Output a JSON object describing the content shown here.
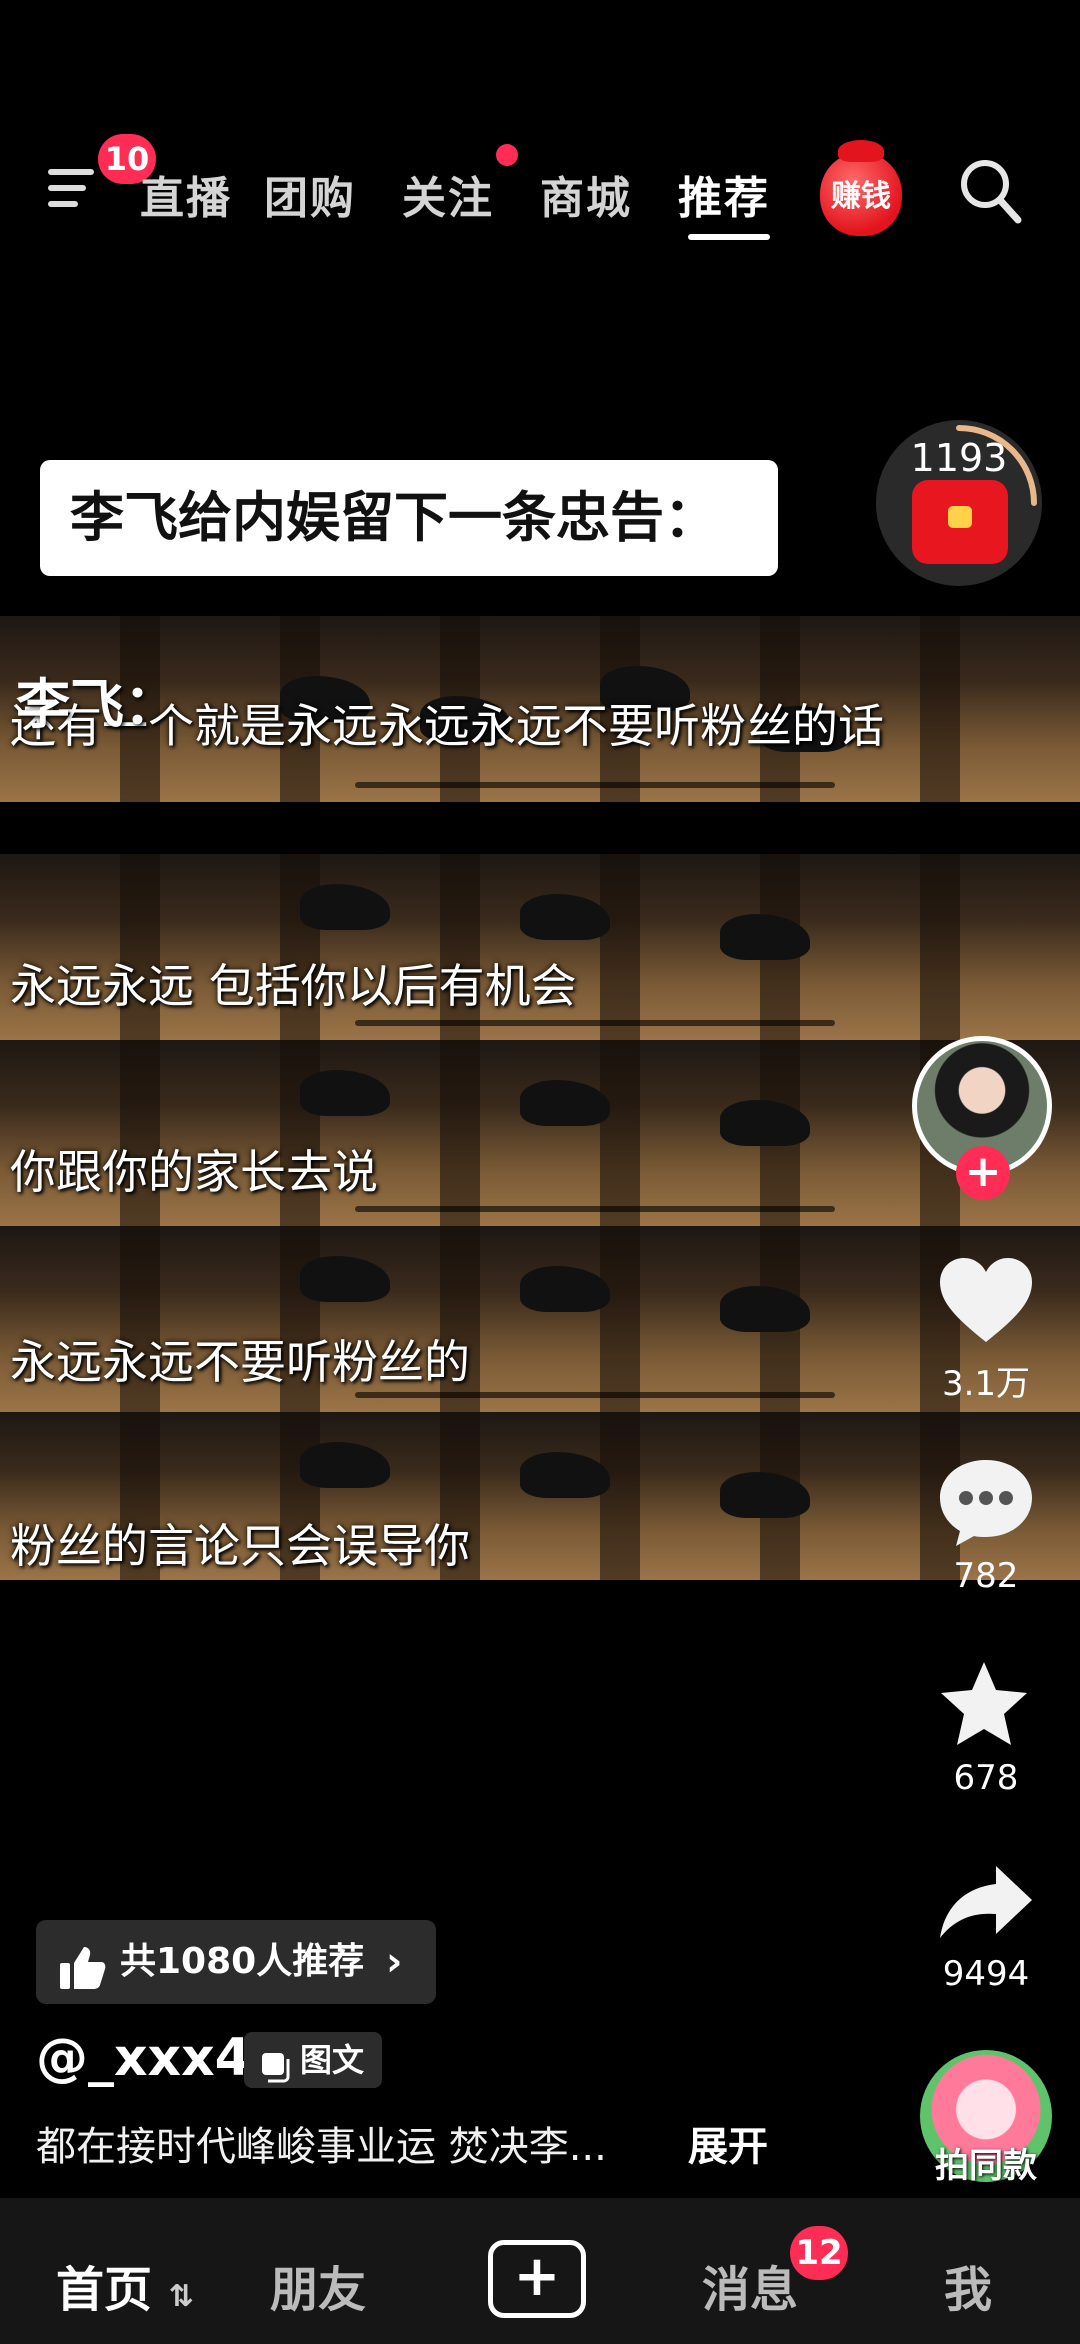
{
  "top_nav": {
    "menu_badge": "10",
    "tabs": [
      "直播",
      "团购",
      "关注",
      "商城",
      "推荐"
    ],
    "active_tab_index": 4,
    "earn_label": "赚钱"
  },
  "video": {
    "caption_title": "李飞给内娱留下一条忠告：",
    "speaker": "李飞：",
    "subtitles": [
      "还有一个就是永远永远永远不要听粉丝的话",
      "永远永远  包括你以后有机会",
      "你跟你的家长去说",
      "永远永远不要听粉丝的",
      "粉丝的言论只会误导你"
    ]
  },
  "timer_widget": {
    "count": "1193"
  },
  "right_rail": {
    "likes": "3.1万",
    "comments": "782",
    "favorites": "678",
    "shares": "9494",
    "remix_label": "拍同款"
  },
  "info": {
    "recommend_text": "共1080人推荐",
    "username": "@_xxx4",
    "type_tag": "图文",
    "description": "都在接时代峰峻事业运 焚决李...",
    "expand_label": "展开"
  },
  "bottom_bar": {
    "home": "首页",
    "friends": "朋友",
    "messages": "消息",
    "messages_badge": "12",
    "me": "我"
  },
  "colors": {
    "accent": "#ff2c55",
    "background": "#000000"
  }
}
